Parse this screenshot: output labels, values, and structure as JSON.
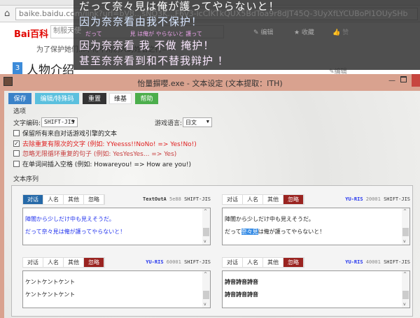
{
  "browser": {
    "url": "baike.baidu.com/link?url=bV8...sNQ3K...F6v3-lcCIKTkQUX5BdToa9r8dJT45Q-3UyXfLYCUBoPl1OUySHb",
    "logo": "Bai百科",
    "search_value": "制服天使",
    "actions": [
      "✎ 编辑",
      "★ 收藏",
      "👍 赞"
    ],
    "body_line": "为了保护她们...不得不用别人的姓名之行——",
    "section_number": "3",
    "section_title": "人物介绍",
    "section_edit": "✎编辑"
  },
  "overlay": {
    "lines": [
      "だって奈々見は俺が護ってやらないと！",
      "因为奈奈看由我不保护！",
      "だって　　　　　見 は俺が やらないと 護って",
      "因为奈奈看 我  不做 掩护！",
      "甚至奈奈看到和不替我辩护 ！"
    ]
  },
  "window": {
    "title": "怡量摒嚶.exe - 文本设定 (文本提取：ITH)",
    "buttons": {
      "save": "保存",
      "edit": "编辑/特殊码",
      "reset": "重置",
      "wiki": "维基",
      "help": "帮助"
    },
    "options_label": "选项",
    "encoding_label": "文字编码:",
    "encoding_value": "SHIFT-JIS",
    "language_label": "游戏语言:",
    "language_value": "日文",
    "checkboxes": [
      {
        "label": "保留所有来自对话游戏引擎的文本",
        "checked": false
      },
      {
        "label": "去除重复有限次的文字 (例如: YYeesss!!NoNo! => Yes!No!)",
        "checked": true
      },
      {
        "label": "忽略无限循环重复的句子 (例如: YesYesYes... => Yes)",
        "checked": false
      },
      {
        "label": "在单词间插入空格 (例如: Howareyou! => How are you!)",
        "checked": false
      }
    ],
    "sequence_label": "文本序列",
    "tab_labels": [
      "对话",
      "人名",
      "其他",
      "忽略"
    ],
    "panels": [
      {
        "engine": "TextOutA",
        "id": "5e88",
        "encoding": "SHIFT-JIS",
        "lines": [
          "陣闇から少しだけ中も見えそうだ。",
          "だって奈々見は俺が護ってやらないと！"
        ]
      },
      {
        "engine": "YU-RIS",
        "id": "20001",
        "encoding": "SHIFT-JIS",
        "line1": "陣闇から少しだけ中も見えそうだ。",
        "line2_pre": "だって",
        "line2_hl": "奈々見",
        "line2_post": "は俺が護ってやらないと！"
      },
      {
        "engine": "YU-RIS",
        "id": "60001",
        "encoding": "SHIFT-JIS",
        "lines": [
          "ケントケントケント",
          "ケントケントケント"
        ]
      },
      {
        "engine": "YU-RIS",
        "id": "40001",
        "encoding": "SHIFT-JIS",
        "lines": [
          "詩音詩音詩音",
          "詩音詩音詩音"
        ]
      }
    ],
    "scroll_up": "^",
    "scroll_down": "v",
    "dropdown_arrow": "▼"
  }
}
